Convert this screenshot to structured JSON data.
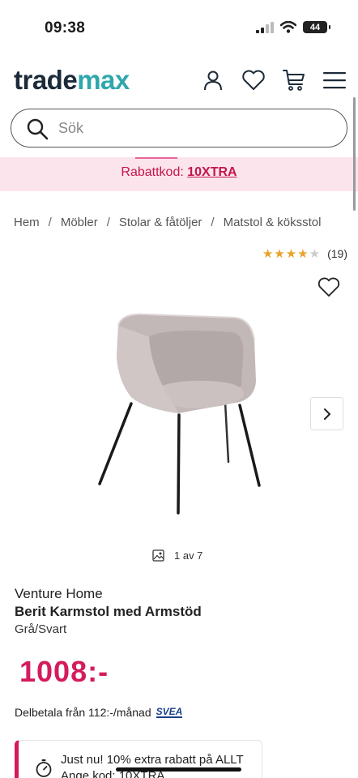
{
  "status_bar": {
    "time": "09:38",
    "battery": "44"
  },
  "header": {
    "logo_part1": "trade",
    "logo_part2": "max"
  },
  "search": {
    "placeholder": "Sök"
  },
  "promo": {
    "prefix": "Rabattkod: ",
    "code": "10XTRA"
  },
  "breadcrumb": [
    "Hem",
    "Möbler",
    "Stolar & fåtöljer",
    "Matstol & köksstol"
  ],
  "breadcrumb_separator": "/",
  "rating": {
    "stars": 4.5,
    "count": "(19)"
  },
  "gallery": {
    "counter": "1 av 7"
  },
  "product": {
    "brand": "Venture Home",
    "title": "Berit Karmstol med Armstöd",
    "variant": "Grå/Svart",
    "price": "1008:-",
    "installment": "Delbetala från 112:-/månad",
    "installment_provider": "SVEA"
  },
  "deal": {
    "line1": "Just nu! 10% extra rabatt på ALLT",
    "line2": "Ange kod: 10XTRA"
  },
  "colors": {
    "accent": "#d41b5d",
    "logo_dark": "#1c2b39",
    "logo_teal": "#2fa7ad",
    "promo_bg": "#fbe4ec",
    "star": "#e8a32a"
  },
  "icons": [
    "signal-icon",
    "wifi-icon",
    "battery-icon",
    "account-icon",
    "wishlist-heart-icon",
    "cart-icon",
    "menu-icon",
    "search-icon",
    "heart-icon",
    "chevron-right-icon",
    "image-icon",
    "clock-icon"
  ]
}
